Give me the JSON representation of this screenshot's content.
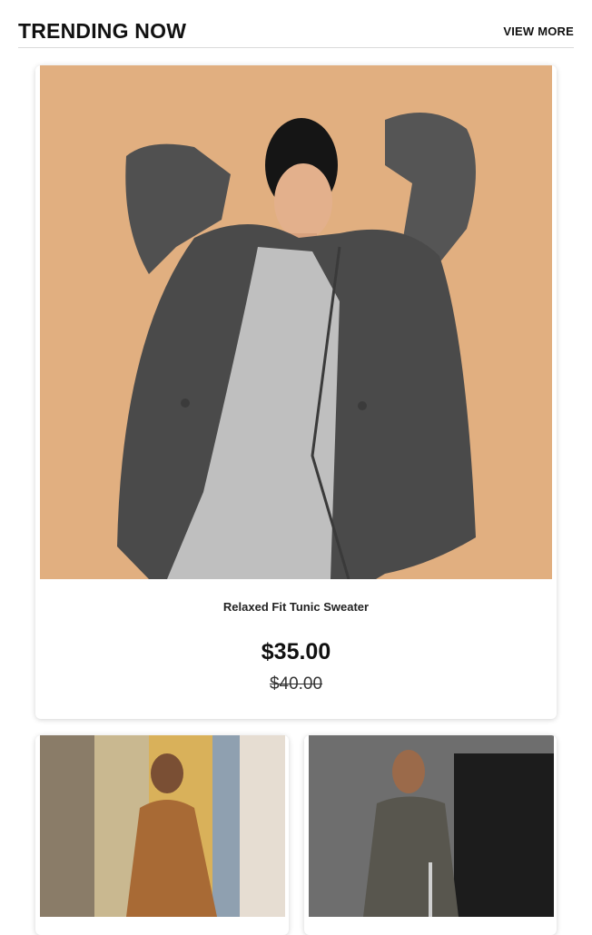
{
  "section": {
    "title": "TRENDING NOW",
    "view_more_label": "VIEW MORE"
  },
  "featured_product": {
    "name": "Relaxed Fit Tunic Sweater",
    "price": "$35.00",
    "original_price": "$40.00"
  },
  "colors": {
    "background": "#ffffff",
    "featured_photo_backdrop": "#e0ae7f",
    "blazer_gray": "#4a4a4a"
  }
}
